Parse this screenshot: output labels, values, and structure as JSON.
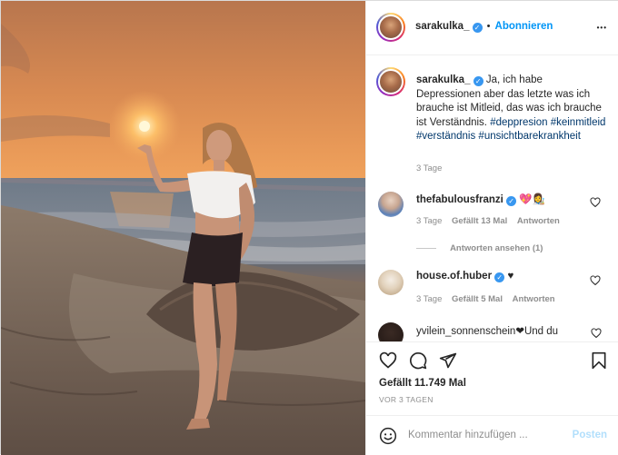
{
  "post": {
    "username": "sarakulka_",
    "separator": "•",
    "follow_label": "Abonnieren",
    "more_label": "•••"
  },
  "caption": {
    "username": "sarakulka_",
    "text": "Ja, ich habe Depressionen aber das letzte was ich brauche ist Mitleid, das was ich brauche ist Verständnis.",
    "hashtags": [
      "#deppresion",
      "#keinmitleid",
      "#verständnis",
      "#unsichtbarekrankheit"
    ],
    "time": "3 Tage"
  },
  "comments": [
    {
      "username": "thefabulousfranzi",
      "text": "💖👩‍🎨",
      "time": "3 Tage",
      "likes": "Gefällt 13 Mal",
      "reply": "Antworten",
      "view_replies": "Antworten ansehen (1)"
    },
    {
      "username": "house.of.huber",
      "text": "♥",
      "time": "3 Tage",
      "likes": "Gefällt 5 Mal",
      "reply": "Antworten"
    },
    {
      "username": "yvilein_sonnenschein",
      "text": "❤Und du",
      "time": "",
      "likes": "",
      "reply": ""
    }
  ],
  "footer": {
    "likes": "Gefällt 11.749 Mal",
    "date": "VOR 3 TAGEN",
    "comment_placeholder": "Kommentar hinzufügen ...",
    "post_label": "Posten"
  },
  "icons": {
    "like": "heart-icon",
    "comment": "comment-icon",
    "share": "share-icon",
    "save": "bookmark-icon",
    "emoji": "emoji-icon"
  },
  "colors": {
    "accent": "#0095f6",
    "hashtag": "#00376b",
    "muted": "#8e8e8e",
    "verified": "#3897f0"
  }
}
